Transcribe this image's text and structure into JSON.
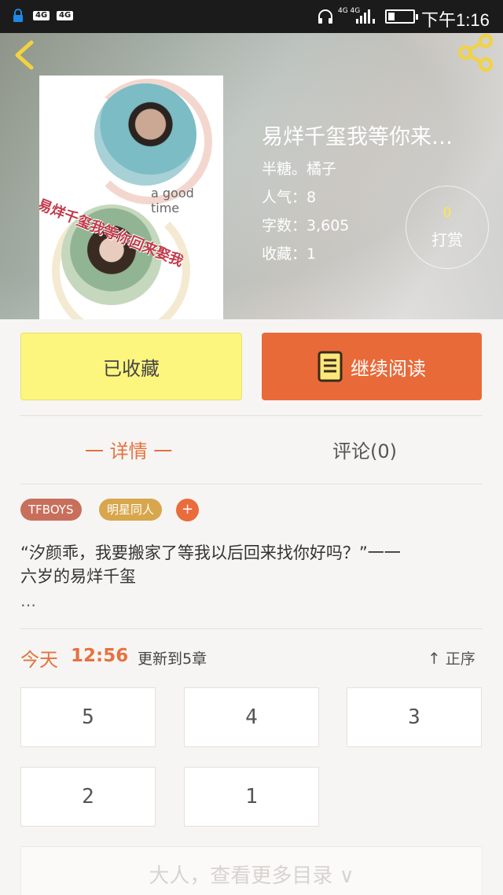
{
  "status_bar": {
    "sim1": "4G",
    "sim2": "4G",
    "network": "4G 4G",
    "time": "下午1:16"
  },
  "header": {
    "book_title": "易烊千玺我等你来…",
    "author": "半糖。橘子",
    "popularity": "人气：8",
    "word_count": "字数：3,605",
    "favorites": "收藏：1",
    "tip_count": "0",
    "tip_label": "打赏",
    "cover_text": "易烊千玺我等你回来娶我",
    "cover_subtext": "a good time"
  },
  "actions": {
    "favorited_label": "已收藏",
    "continue_label": "继续阅读"
  },
  "tabs": [
    {
      "label": "一 详情 一",
      "active": true
    },
    {
      "label": "评论(0)",
      "active": false
    }
  ],
  "tags": [
    "TFBOYS",
    "明星同人"
  ],
  "tag_add": "+",
  "description": "“汐颜乖，我要搬家了等我以后回来找你好吗？”一一六岁的易烊千玺",
  "description_more": "…",
  "update": {
    "day": "今天",
    "time": "12:56",
    "text": "更新到5章",
    "order_label": "正序"
  },
  "chapters": [
    "5",
    "4",
    "3",
    "2",
    "1"
  ],
  "more_catalog": "大人，查看更多目录 ∨",
  "colors": {
    "accent": "#e96a39",
    "favorite_bg": "#fcf67f",
    "tag1": "#c86f5c",
    "tag2": "#d8a64c"
  },
  "icons": [
    "back-arrow-icon",
    "share-icon",
    "book-icon",
    "arrow-up-icon"
  ]
}
